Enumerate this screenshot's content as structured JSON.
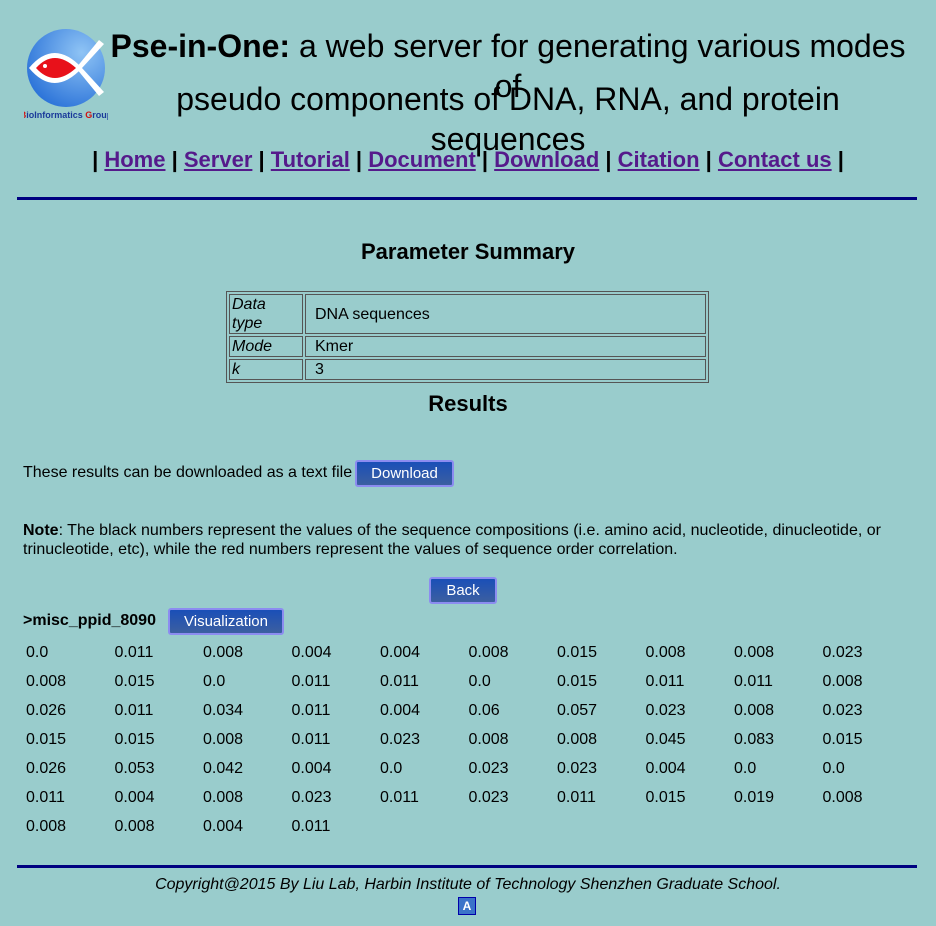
{
  "header": {
    "logo_text": "BioInformatics Group",
    "title_bold": "Pse-in-One:",
    "title_rest": " a web server for generating various modes of",
    "title_line2": "pseudo components of DNA, RNA, and protein sequences"
  },
  "nav": [
    {
      "label": "Home"
    },
    {
      "label": "Server"
    },
    {
      "label": "Tutorial"
    },
    {
      "label": "Document"
    },
    {
      "label": "Download"
    },
    {
      "label": "Citation"
    },
    {
      "label": "Contact us"
    }
  ],
  "summary": {
    "heading": "Parameter Summary",
    "rows": [
      {
        "key": "Data type",
        "value": "DNA sequences"
      },
      {
        "key": "Mode",
        "value": "Kmer"
      },
      {
        "key": "k",
        "value": "3"
      }
    ]
  },
  "results": {
    "heading": "Results",
    "download_text": "These results can be downloaded as a text file",
    "download_label": "Download",
    "note_label": "Note",
    "note_text": ": The black numbers represent the values of the sequence compositions (i.e. amino acid, nucleotide, dinucleotide, or",
    "note_text2": "trinucleotide, etc), while the red numbers represent the values of sequence order correlation.",
    "back_label": "Back",
    "sequence_name": ">misc_ppid_8090",
    "visualization_label": "Visualization",
    "values": [
      "0.0",
      "0.011",
      "0.008",
      "0.004",
      "0.004",
      "0.008",
      "0.015",
      "0.008",
      "0.008",
      "0.023",
      "0.008",
      "0.015",
      "0.0",
      "0.011",
      "0.011",
      "0.0",
      "0.015",
      "0.011",
      "0.011",
      "0.008",
      "0.026",
      "0.011",
      "0.034",
      "0.011",
      "0.004",
      "0.06",
      "0.057",
      "0.023",
      "0.008",
      "0.023",
      "0.015",
      "0.015",
      "0.008",
      "0.011",
      "0.023",
      "0.008",
      "0.008",
      "0.045",
      "0.083",
      "0.015",
      "0.026",
      "0.053",
      "0.042",
      "0.004",
      "0.0",
      "0.023",
      "0.023",
      "0.004",
      "0.0",
      "0.0",
      "0.011",
      "0.004",
      "0.008",
      "0.023",
      "0.011",
      "0.023",
      "0.011",
      "0.015",
      "0.019",
      "0.008",
      "0.008",
      "0.008",
      "0.004",
      "0.011"
    ]
  },
  "footer": {
    "copyright": "Copyright@2015 By Liu Lab, Harbin Institute of Technology Shenzhen Graduate School.",
    "badge": "A"
  },
  "colors": {
    "background": "#99CCCC",
    "link": "#551A8B",
    "rule": "#000080",
    "button": "#1a4fb8"
  }
}
